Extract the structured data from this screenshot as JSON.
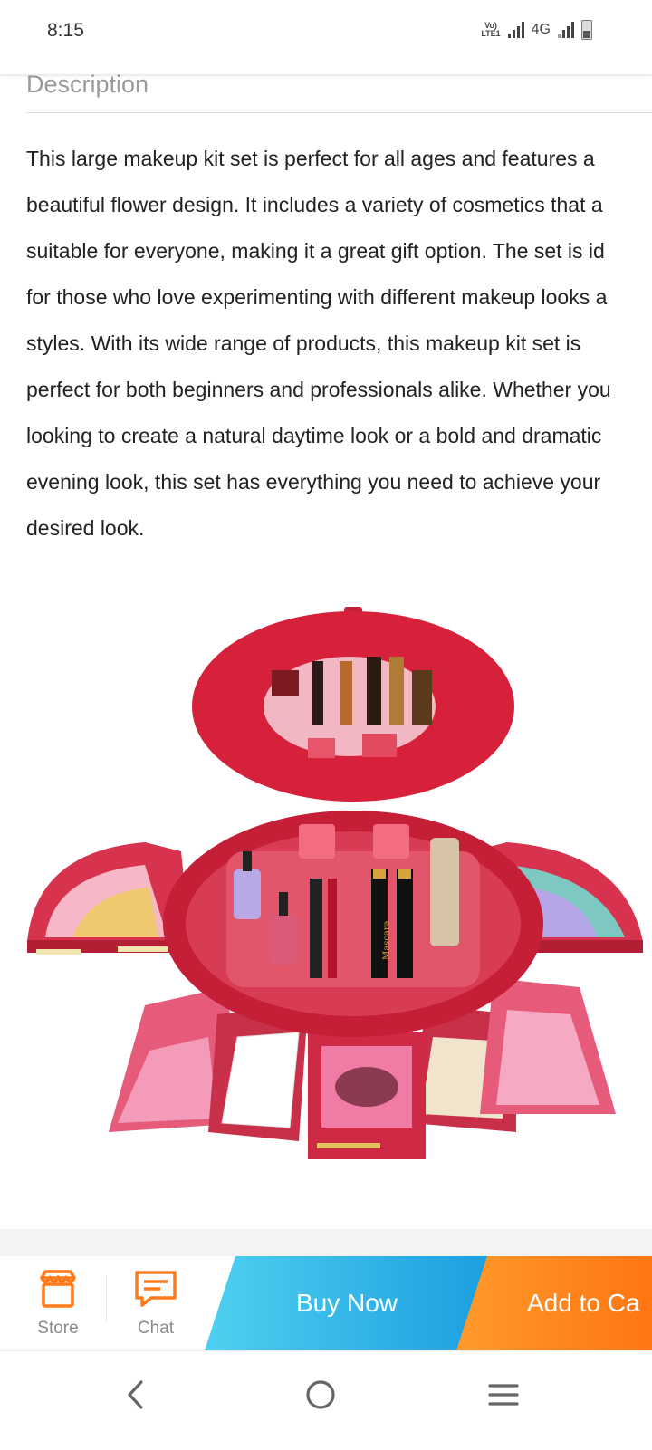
{
  "status_bar": {
    "time": "8:15",
    "volte_label": "Vo) LTE1",
    "network_type": "4G",
    "icons": [
      "signal-icon",
      "signal-icon",
      "battery-icon"
    ]
  },
  "description": {
    "heading": "Description",
    "lines": [
      "This large makeup kit set is perfect for all ages and features a",
      "beautiful flower design. It includes a variety of cosmetics that a",
      "suitable for everyone, making it a great gift option. The set is id",
      "for those who love experimenting with different makeup looks a",
      "styles. With its wide range of products, this makeup kit set is",
      "perfect for both beginners and professionals alike. Whether you",
      "looking to create a natural daytime look or a bold and dramatic",
      "evening look, this set has everything you need to achieve your",
      "desired look."
    ]
  },
  "product_image": {
    "subject": "flower-shaped makeup kit",
    "mascara_label": "Mascara"
  },
  "action_bar": {
    "store_label": "Store",
    "chat_label": "Chat",
    "buy_now_label": "Buy Now",
    "add_to_cart_label": "Add to Ca",
    "colors": {
      "store_icon": "#ff7a1a",
      "buy_now": "#2db3ea",
      "add_to_cart": "#ff8a1f"
    }
  },
  "nav_bar": {
    "icons": [
      "back-icon",
      "home-icon",
      "recents-icon"
    ]
  }
}
